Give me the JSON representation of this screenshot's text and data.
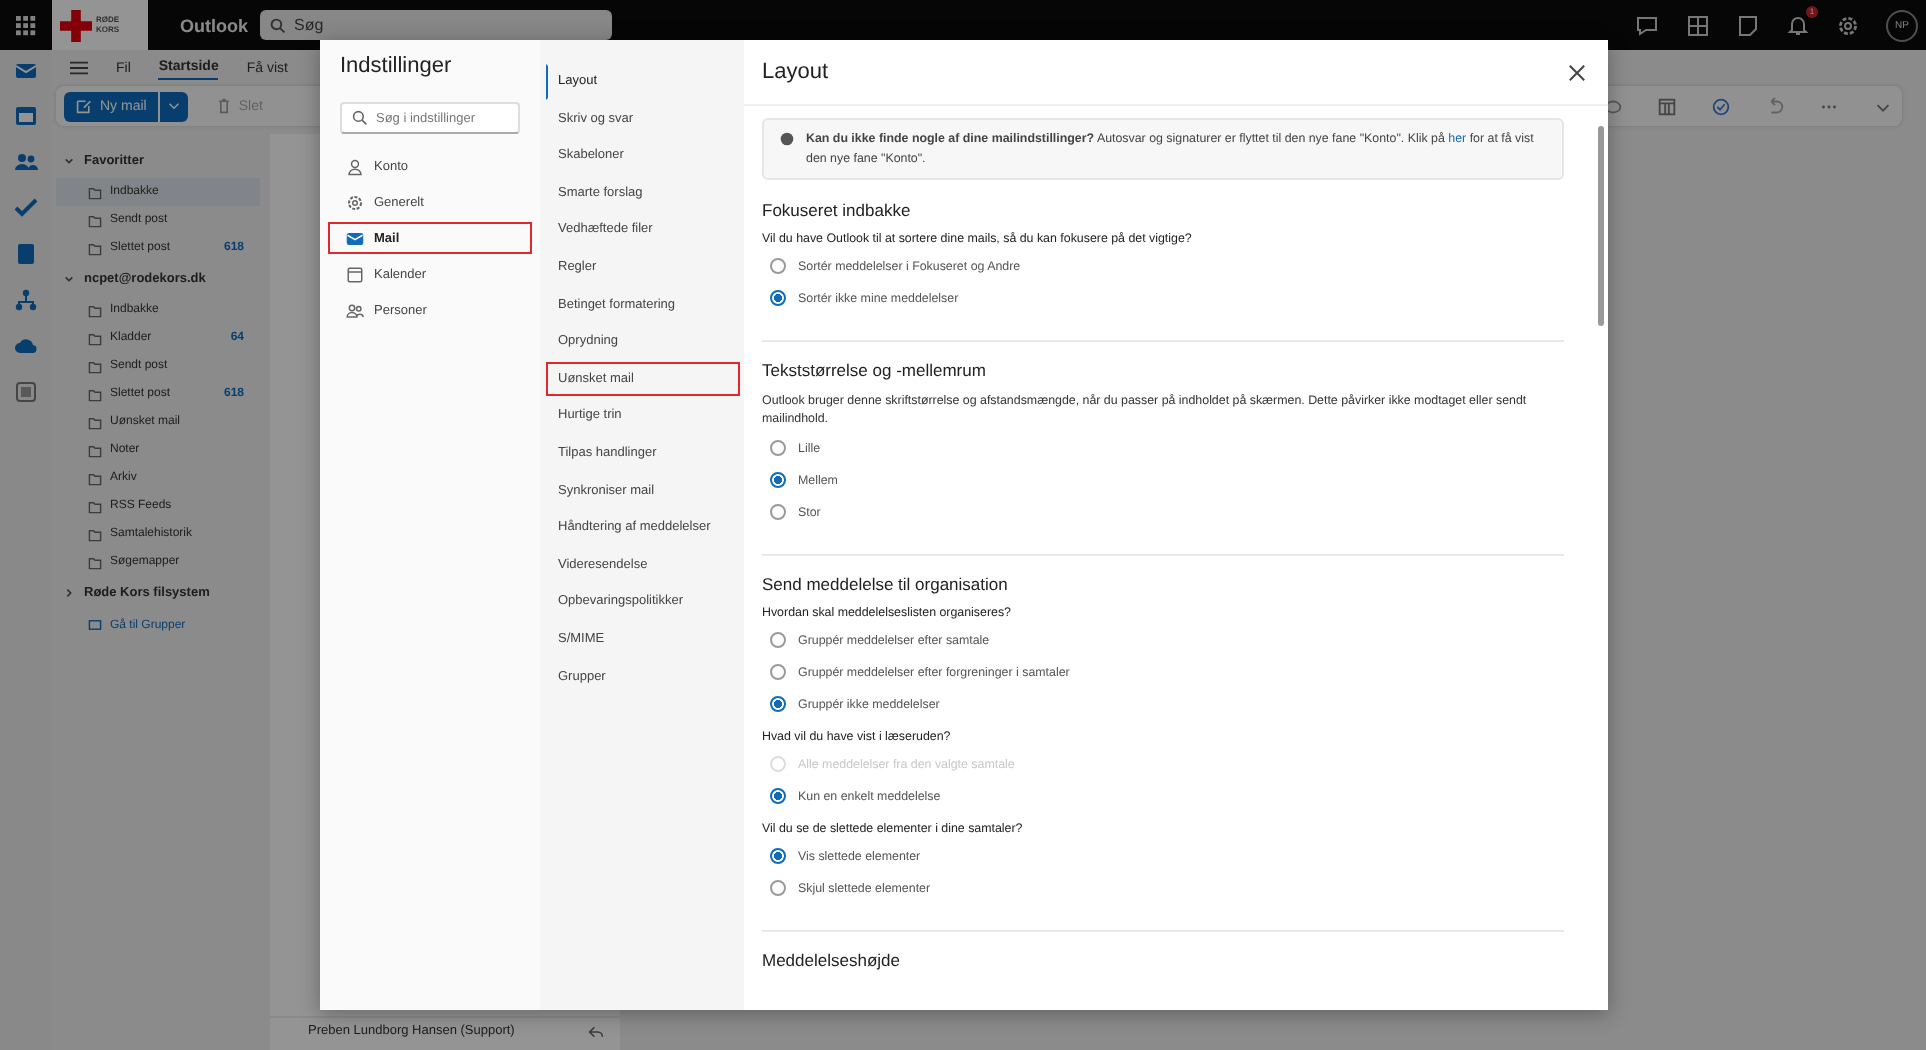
{
  "topbar": {
    "logo_text": "RØDE KORS",
    "app_name": "Outlook",
    "search": {
      "placeholder": "Søg"
    },
    "notification_badge": "1",
    "avatar": "NP"
  },
  "ribbon": {
    "tabs": [
      {
        "label": "Fil",
        "selected": false
      },
      {
        "label": "Startside",
        "selected": true
      },
      {
        "label": "Få vist",
        "selected": false
      }
    ],
    "new_mail": "Ny mail",
    "delete": "Slet"
  },
  "folders": {
    "sections": [
      {
        "label": "Favoritter",
        "expanded": true,
        "items": [
          {
            "label": "Indbakke",
            "selected": true
          },
          {
            "label": "Sendt post",
            "selected": false
          },
          {
            "label": "Slettet post",
            "count": "618",
            "selected": false
          }
        ]
      },
      {
        "label": "ncpet@rodekors.dk",
        "expanded": true,
        "items": [
          {
            "label": "Indbakke",
            "selected": false
          },
          {
            "label": "Kladder",
            "count": "64",
            "selected": false
          },
          {
            "label": "Sendt post",
            "selected": false
          },
          {
            "label": "Slettet post",
            "count": "618",
            "selected": false
          },
          {
            "label": "Uønsket mail",
            "selected": false
          },
          {
            "label": "Noter",
            "selected": false
          },
          {
            "label": "Arkiv",
            "selected": false
          },
          {
            "label": "RSS Feeds",
            "selected": false
          },
          {
            "label": "Samtalehistorik",
            "selected": false
          },
          {
            "label": "Søgemapper",
            "selected": false
          }
        ]
      },
      {
        "label": "Røde Kors filsystem",
        "expanded": false
      }
    ],
    "groups_link": "Gå til Grupper"
  },
  "message_list": {
    "rows": [
      {
        "sender": "Preben Lundborg Hansen (Support)"
      }
    ]
  },
  "dialog": {
    "title": "Indstillinger",
    "search": {
      "placeholder": "Søg i indstillinger"
    },
    "categories": [
      {
        "label": "Konto",
        "kind": "person",
        "selected": false,
        "highlighted": false
      },
      {
        "label": "Generelt",
        "kind": "gear",
        "selected": false,
        "highlighted": false
      },
      {
        "label": "Mail",
        "kind": "mail",
        "selected": true,
        "highlighted": true
      },
      {
        "label": "Kalender",
        "kind": "calendar",
        "selected": false,
        "highlighted": false
      },
      {
        "label": "Personer",
        "kind": "people",
        "selected": false,
        "highlighted": false
      }
    ],
    "subnav": [
      {
        "label": "Layout",
        "selected": true,
        "highlighted": false
      },
      {
        "label": "Skriv og svar",
        "selected": false,
        "highlighted": false
      },
      {
        "label": "Skabeloner",
        "selected": false,
        "highlighted": false
      },
      {
        "label": "Smarte forslag",
        "selected": false,
        "highlighted": false
      },
      {
        "label": "Vedhæftede filer",
        "selected": false,
        "highlighted": false
      },
      {
        "label": "Regler",
        "selected": false,
        "highlighted": false
      },
      {
        "label": "Betinget formatering",
        "selected": false,
        "highlighted": false
      },
      {
        "label": "Oprydning",
        "selected": false,
        "highlighted": false
      },
      {
        "label": "Uønsket mail",
        "selected": false,
        "highlighted": true
      },
      {
        "label": "Hurtige trin",
        "selected": false,
        "highlighted": false
      },
      {
        "label": "Tilpas handlinger",
        "selected": false,
        "highlighted": false
      },
      {
        "label": "Synkroniser mail",
        "selected": false,
        "highlighted": false
      },
      {
        "label": "Håndtering af meddelelser",
        "selected": false,
        "highlighted": false
      },
      {
        "label": "Videresendelse",
        "selected": false,
        "highlighted": false
      },
      {
        "label": "Opbevaringspolitikker",
        "selected": false,
        "highlighted": false
      },
      {
        "label": "S/MIME",
        "selected": false,
        "highlighted": false
      },
      {
        "label": "Grupper",
        "selected": false,
        "highlighted": false
      }
    ],
    "page_title": "Layout",
    "info": {
      "text_before": "**Kan du ikke finde nogle af dine mailindstillinger?** Autosvar og signaturer er flyttet til den nye fane \"Konto\". Klik på",
      "link": "her",
      "text_after": "for at få vist den nye fane \"Konto\"."
    },
    "sections": [
      {
        "heading": "Fokuseret indbakke",
        "groups": [
          {
            "question": "Vil du have Outlook til at sortere dine mails, så du kan fokusere på det vigtige?",
            "options": [
              {
                "label": "Sortér meddelelser i Fokuseret og Andre",
                "selected": false,
                "disabled": false
              },
              {
                "label": "Sortér ikke mine meddelelser",
                "selected": true,
                "disabled": false
              }
            ]
          }
        ]
      },
      {
        "heading": "Tekststørrelse og -mellemrum",
        "description": "Outlook bruger denne skriftstørrelse og afstandsmængde, når du passer på indholdet på skærmen. Dette påvirker ikke modtaget eller sendt mailindhold.",
        "groups": [
          {
            "options": [
              {
                "label": "Lille",
                "selected": false,
                "disabled": false
              },
              {
                "label": "Mellem",
                "selected": true,
                "disabled": false
              },
              {
                "label": "Stor",
                "selected": false,
                "disabled": false
              }
            ]
          }
        ]
      },
      {
        "heading": "Send meddelelse til organisation",
        "groups": [
          {
            "question": "Hvordan skal meddelelseslisten organiseres?",
            "options": [
              {
                "label": "Gruppér meddelelser efter samtale",
                "selected": false,
                "disabled": false
              },
              {
                "label": "Gruppér meddelelser efter forgreninger i samtaler",
                "selected": false,
                "disabled": false
              },
              {
                "label": "Gruppér ikke meddelelser",
                "selected": true,
                "disabled": false
              }
            ]
          },
          {
            "question": "Hvad vil du have vist i læseruden?",
            "options": [
              {
                "label": "Alle meddelelser fra den valgte samtale",
                "selected": false,
                "disabled": true
              },
              {
                "label": "Kun en enkelt meddelelse",
                "selected": true,
                "disabled": false
              }
            ]
          },
          {
            "question": "Vil du se de slettede elementer i dine samtaler?",
            "options": [
              {
                "label": "Vis slettede elementer",
                "selected": true,
                "disabled": false
              },
              {
                "label": "Skjul slettede elementer",
                "selected": false,
                "disabled": false
              }
            ]
          }
        ]
      },
      {
        "heading": "Meddelelseshøjde"
      }
    ]
  }
}
